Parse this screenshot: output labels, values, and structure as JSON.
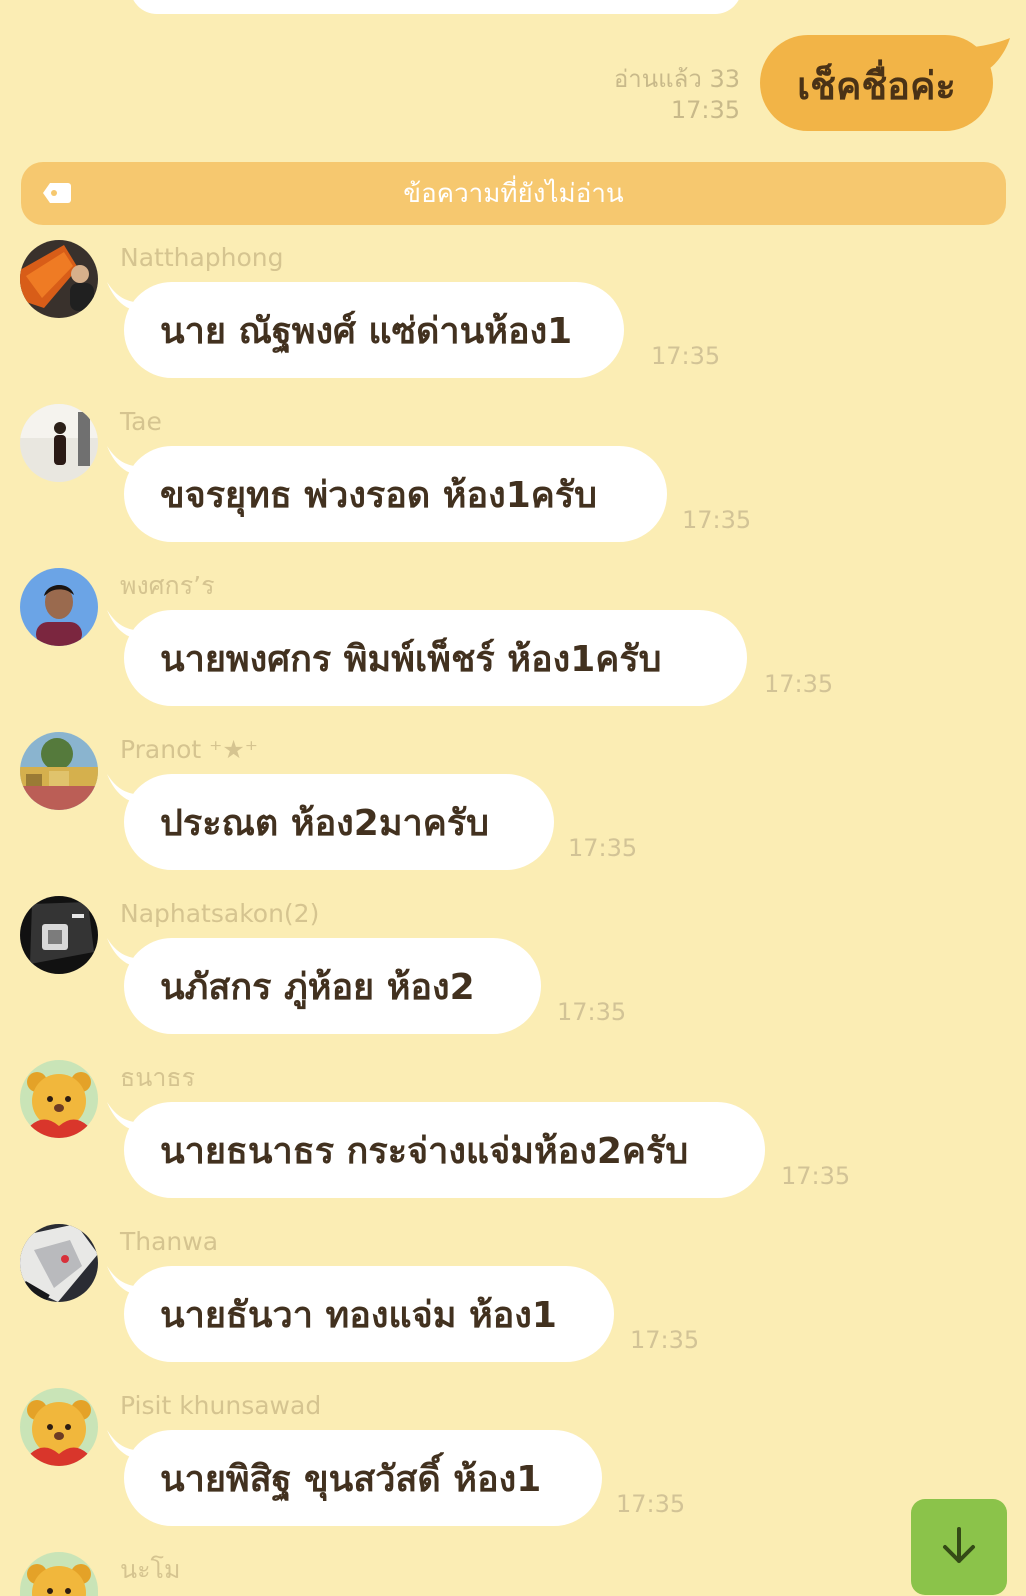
{
  "sent_message": {
    "read_status": "อ่านแล้ว 33",
    "time": "17:35",
    "text": "เช็คชื่อค่ะ"
  },
  "unread_banner": {
    "label": "ข้อความที่ยังไม่อ่าน"
  },
  "messages": [
    {
      "sender": "Natthaphong",
      "text": "นาย ณัฐพงศ์ แซ่ด่านห้อง1",
      "time": "17:35"
    },
    {
      "sender": "Tae",
      "text": "ขจรยุทธ พ่วงรอด ห้อง1ครับ",
      "time": "17:35"
    },
    {
      "sender": "พงศกร’ร",
      "text": "นายพงศกร พิมพ์เพ็ชร์ ห้อง1ครับ",
      "time": "17:35"
    },
    {
      "sender": "Pranot ⁺★⁺",
      "text": "ประณต ห้อง2มาครับ",
      "time": "17:35"
    },
    {
      "sender": "Naphatsakon(2)",
      "text": "นภัสกร ภู่ห้อย ห้อง2",
      "time": "17:35"
    },
    {
      "sender": "ธนาธร",
      "text": "นายธนาธร กระจ่างแจ่มห้อง2ครับ",
      "time": "17:35"
    },
    {
      "sender": "Thanwa",
      "text": "นายธันวา ทองแจ่ม ห้อง1",
      "time": "17:35"
    },
    {
      "sender": "Pisit khunsawad",
      "text": "นายพิสิฐ ขุนสวัสดิ์ ห้อง1",
      "time": "17:35"
    },
    {
      "sender": "นะโม"
    }
  ],
  "colors": {
    "background": "#fbedb4",
    "sent_bubble": "#f2b447",
    "received_bubble": "#ffffff",
    "unread_banner": "#f6c86f",
    "scroll_button": "#8bc34a",
    "meta_text": "#d2c396"
  },
  "icons": {
    "unread": "tag-icon",
    "scroll": "arrow-down-icon"
  }
}
